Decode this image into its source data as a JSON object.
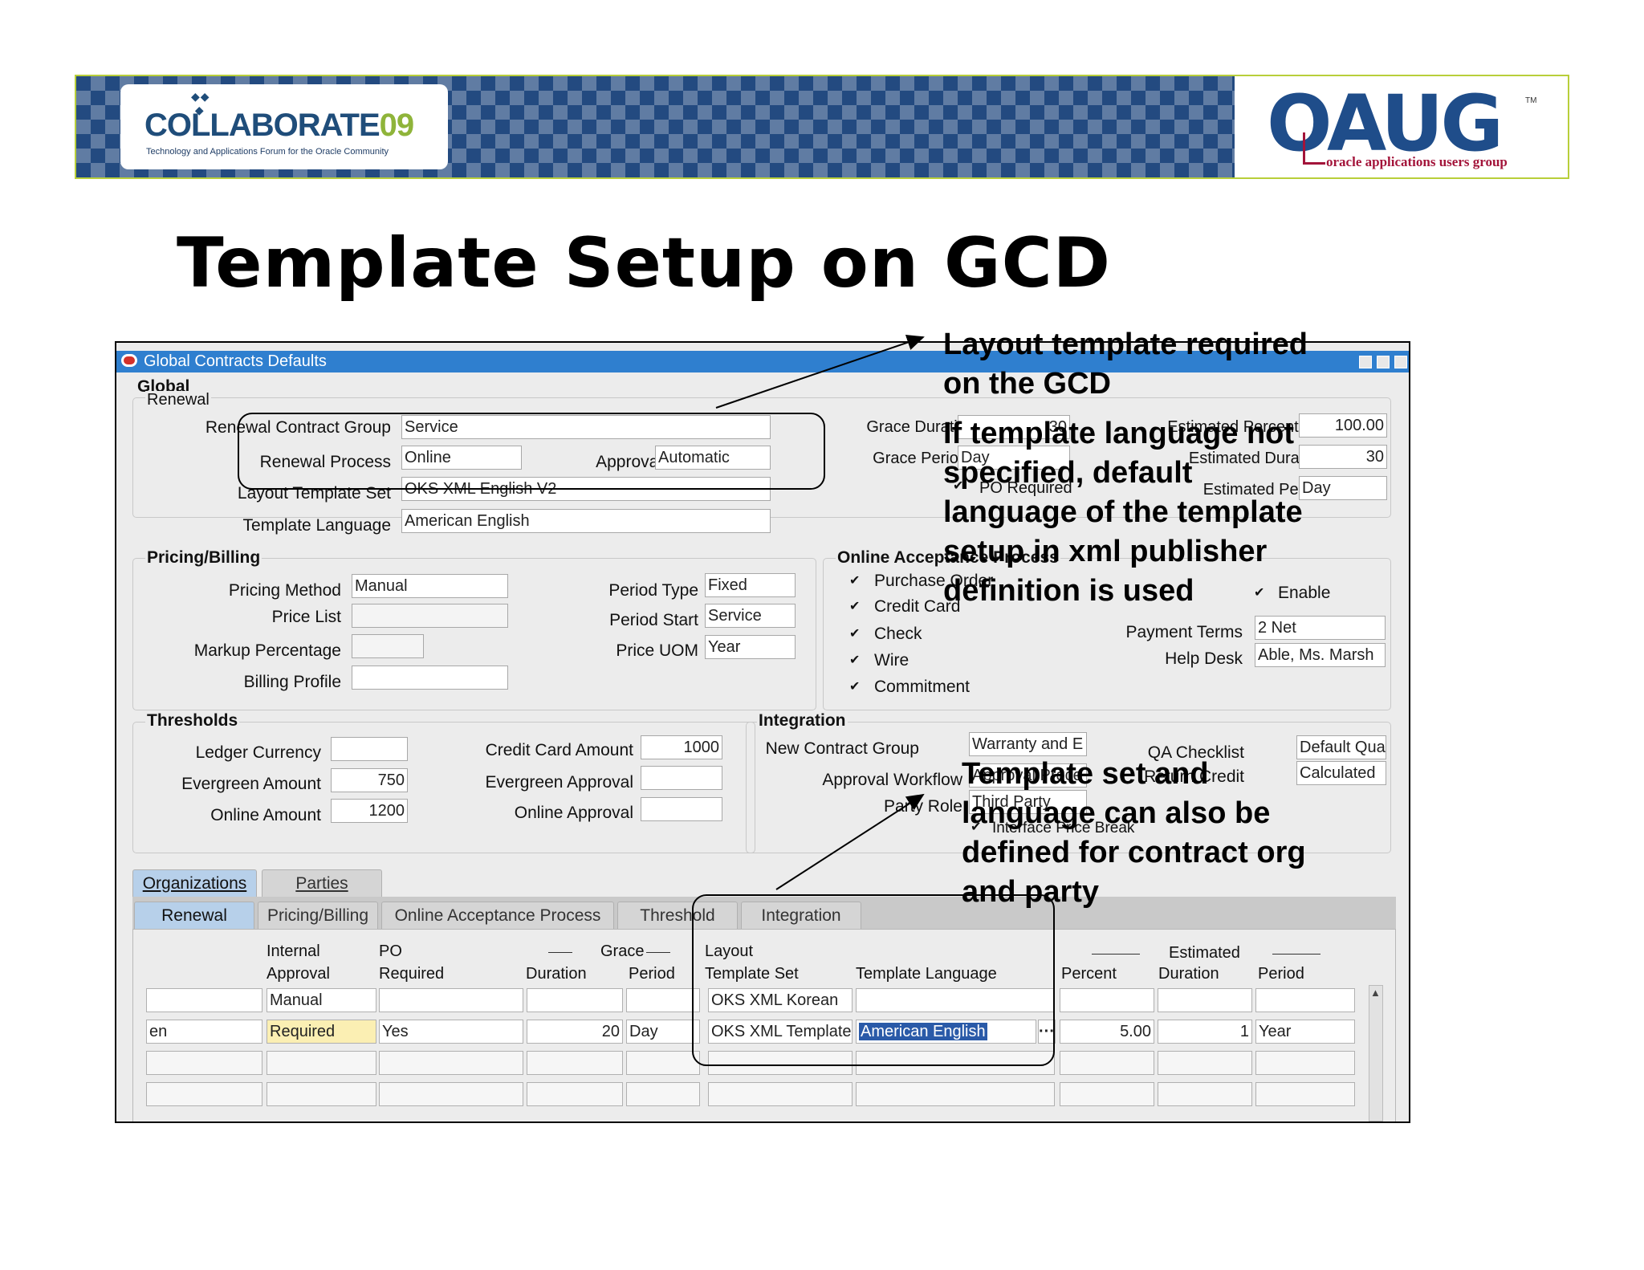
{
  "banner": {
    "collab_name": "COLLABORATE",
    "collab_year": "09",
    "collab_tagline": "Technology and Applications Forum for the Oracle Community",
    "oaug_name": "OAUG",
    "oaug_tm": "TM",
    "oaug_subtitle": "oracle applications users group"
  },
  "slide_title": "Template Setup on GCD",
  "window": {
    "title": "Global Contracts Defaults",
    "global_header": "Global",
    "renewal": {
      "header": "Renewal",
      "contract_group_label": "Renewal Contract Group",
      "contract_group_value": "Service",
      "process_label": "Renewal Process",
      "process_value": "Online",
      "approval_label": "Approval",
      "approval_value": "Automatic",
      "layout_set_label": "Layout Template Set",
      "layout_set_value": "OKS XML English V2",
      "template_language_label": "Template Language",
      "template_language_value": "American English",
      "grace_duration_label": "Grace Duration",
      "grace_duration_value": "30",
      "grace_period_label": "Grace Period",
      "grace_period_value": "Day",
      "po_required_label": "PO Required",
      "estimated_percentage_label": "Estimated Percentage",
      "estimated_percentage_value": "100.00",
      "estimated_duration_label": "Estimated Duration",
      "estimated_duration_value": "30",
      "estimated_period_label": "Estimated Period",
      "estimated_period_value": "Day"
    },
    "pricing": {
      "header": "Pricing/Billing",
      "method_label": "Pricing Method",
      "method_value": "Manual",
      "price_list_label": "Price List",
      "markup_label": "Markup Percentage",
      "billing_profile_label": "Billing Profile",
      "period_type_label": "Period Type",
      "period_type_value": "Fixed",
      "period_start_label": "Period Start",
      "period_start_value": "Service",
      "price_uom_label": "Price UOM",
      "price_uom_value": "Year"
    },
    "online": {
      "header": "Online Acceptance Process",
      "purchase_order": "Purchase Order",
      "credit_card": "Credit Card",
      "check": "Check",
      "wire": "Wire",
      "commitment": "Commitment",
      "enable_label": "Enable",
      "payment_terms_label": "Payment Terms",
      "payment_terms_value": "2 Net",
      "help_desk_label": "Help Desk",
      "help_desk_value": "Able, Ms. Marsh"
    },
    "thresholds": {
      "header": "Thresholds",
      "ledger_currency_label": "Ledger Currency",
      "evergreen_amount_label": "Evergreen Amount",
      "evergreen_amount_value": "750",
      "online_amount_label": "Online Amount",
      "online_amount_value": "1200",
      "credit_card_amount_label": "Credit Card Amount",
      "credit_card_amount_value": "1000",
      "evergreen_approval_label": "Evergreen Approval",
      "online_approval_label": "Online Approval"
    },
    "integration": {
      "header": "Integration",
      "new_contract_group_label": "New Contract Group",
      "new_contract_group_value": "Warranty and E",
      "approval_workflow_label": "Approval Workflow",
      "approval_workflow_value": "Approval Proce",
      "party_role_label": "Party Role",
      "party_role_value": "Third Party",
      "interface_price_break_label": "Interface Price Break",
      "qa_checklist_label": "QA Checklist",
      "qa_checklist_value": "Default Qua",
      "return_credit_label": "Return Credit",
      "return_credit_value": "Calculated"
    },
    "outer_tabs": [
      "Organizations",
      "Parties"
    ],
    "inner_tabs": [
      "Renewal",
      "Pricing/Billing",
      "Online Acceptance Process",
      "Threshold",
      "Integration"
    ],
    "grid": {
      "headers": {
        "internal": "Internal",
        "approval": "Approval",
        "po": "PO",
        "required": "Required",
        "grace": "Grace",
        "duration": "Duration",
        "period": "Period",
        "layout": "Layout",
        "template_set": "Template Set",
        "template_language": "Template Language",
        "percent": "Percent",
        "estimated": "Estimated",
        "est_duration": "Duration",
        "est_period": "Period"
      },
      "row1": {
        "approval": "Manual",
        "template_set": "OKS XML Korean"
      },
      "row2": {
        "first": "en",
        "approval": "Required",
        "po_required": "Yes",
        "grace_duration": "20",
        "grace_period": "Day",
        "template_set": "OKS XML Template",
        "template_language": "American English",
        "percent": "5.00",
        "est_duration": "1",
        "est_period": "Year"
      }
    }
  },
  "callouts": {
    "layout_required": [
      "Layout template required",
      "on the GCD"
    ],
    "language_default": [
      "If template language not",
      "specified, default",
      "language of the template",
      "setup in xml publisher",
      "definition is used"
    ],
    "org_party": [
      "Template set and",
      "language can also be",
      "defined for contract org",
      "and party"
    ]
  }
}
